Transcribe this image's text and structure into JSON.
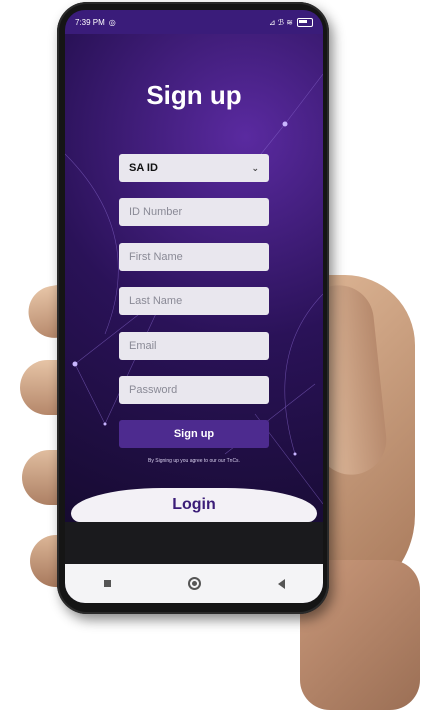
{
  "status_bar": {
    "time": "7:39 PM",
    "right_text": "⊿ ℬ ≋"
  },
  "page": {
    "title": "Sign up"
  },
  "form": {
    "id_type_selected": "SA ID",
    "id_number_placeholder": "ID Number",
    "first_name_placeholder": "First Name",
    "last_name_placeholder": "Last Name",
    "email_placeholder": "Email",
    "password_placeholder": "Password",
    "signup_label": "Sign up",
    "terms_text": "By Signing up you agree to our our TnCs."
  },
  "footer": {
    "login_label": "Login"
  },
  "colors": {
    "accent": "#4d2b8f",
    "background": "#1b0d3a",
    "status_bar": "#3a1c7a"
  }
}
